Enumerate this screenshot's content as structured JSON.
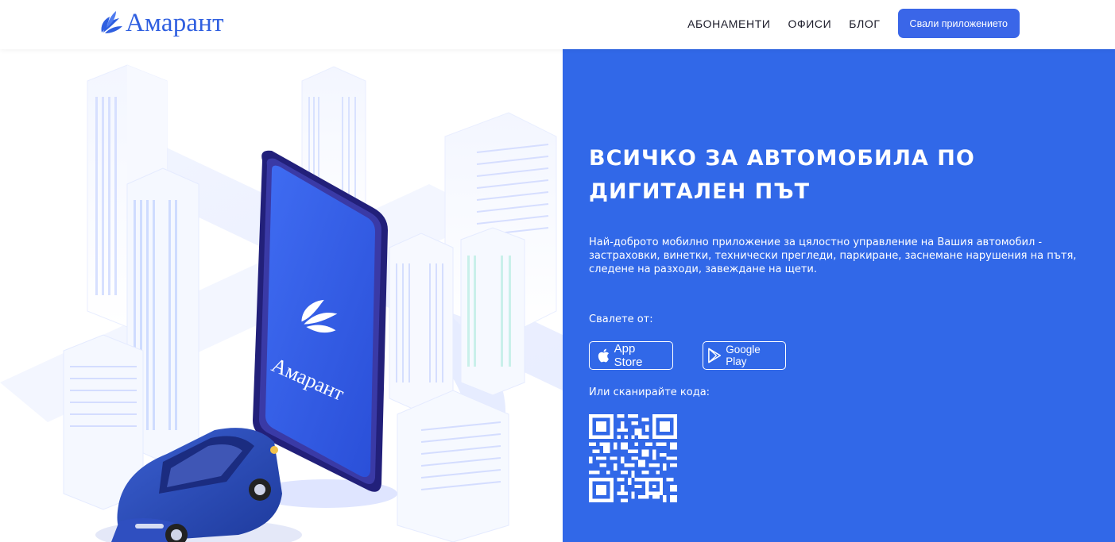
{
  "brand": {
    "name": "Амарант",
    "color": "#2f5fe0"
  },
  "nav": {
    "items": [
      {
        "label": "АБОНАМЕНТИ"
      },
      {
        "label": "ОФИСИ"
      },
      {
        "label": "БЛОГ"
      }
    ],
    "cta_label": "Свали приложението"
  },
  "hero": {
    "headline_line1": "ВСИЧКО ЗА АВТОМОБИЛА ПО",
    "headline_line2": "ДИГИТАЛЕН ПЪТ",
    "description": "Най-доброто мобилно приложение за цялостно управление на Вашия автомобил - застраховки, винетки, технически прегледи, паркиране, заснемане нарушения на пътя, следене на разходи, завеждане на щети.",
    "download_label": "Свалете от:",
    "stores": [
      {
        "label": "App Store",
        "icon": "apple-icon"
      },
      {
        "label": "Google Play",
        "icon": "google-play-icon"
      }
    ],
    "scan_label": "Или сканирайте кода:",
    "panel_color": "#3168e8"
  },
  "illustration": {
    "phone_brand": "Амарант"
  }
}
